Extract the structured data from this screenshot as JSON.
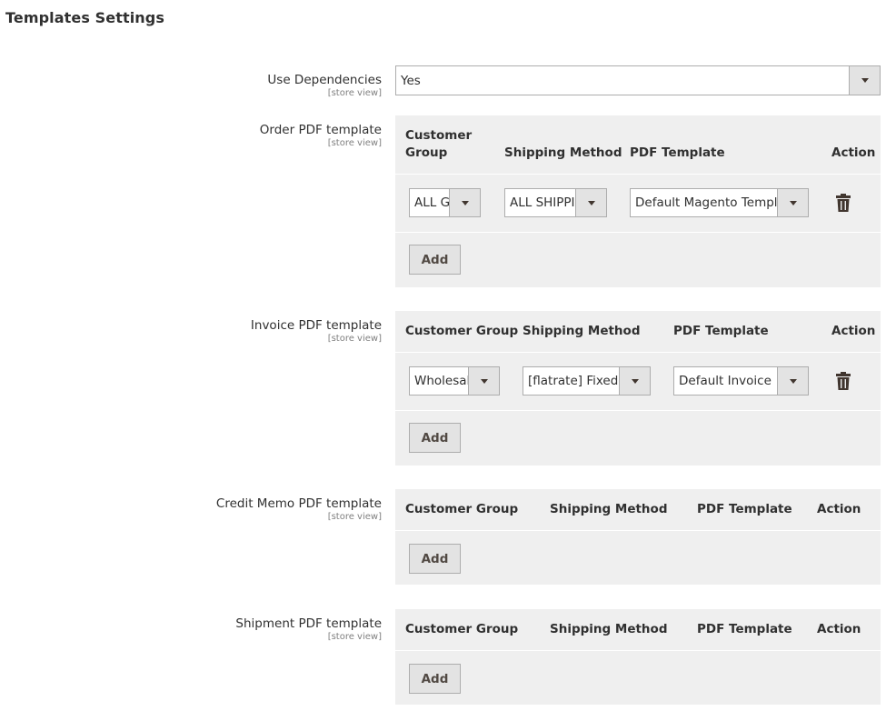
{
  "section_title": "Templates Settings",
  "use_dependencies": {
    "label": "Use Dependencies",
    "scope": "[store view]",
    "value": "Yes"
  },
  "order": {
    "label": "Order PDF template",
    "scope": "[store view]",
    "headers": {
      "customer_group_1": "Customer",
      "customer_group_2": "Group",
      "shipping_method": "Shipping Method",
      "pdf_template": "PDF Template",
      "action": "Action"
    },
    "row": {
      "customer_group": "ALL GROUPS",
      "shipping_method": "ALL SHIPPING",
      "pdf_template": "Default Magento Template"
    },
    "add_label": "Add"
  },
  "invoice": {
    "label": "Invoice PDF template",
    "scope": "[store view]",
    "headers": {
      "customer_group": "Customer Group",
      "shipping_method": "Shipping Method",
      "pdf_template": "PDF Template",
      "action": "Action"
    },
    "row": {
      "customer_group": "Wholesale",
      "shipping_method": "[flatrate] Fixed",
      "pdf_template": "Default Invoice"
    },
    "add_label": "Add"
  },
  "creditmemo": {
    "label": "Credit Memo PDF template",
    "scope": "[store view]",
    "headers": {
      "customer_group": "Customer Group",
      "shipping_method": "Shipping Method",
      "pdf_template": "PDF Template",
      "action": "Action"
    },
    "add_label": "Add"
  },
  "shipment": {
    "label": "Shipment PDF template",
    "scope": "[store view]",
    "headers": {
      "customer_group": "Customer Group",
      "shipping_method": "Shipping Method",
      "pdf_template": "PDF Template",
      "action": "Action"
    },
    "add_label": "Add"
  },
  "icons": {
    "select_arrow": "chevron-down-icon",
    "delete": "trash-icon"
  }
}
